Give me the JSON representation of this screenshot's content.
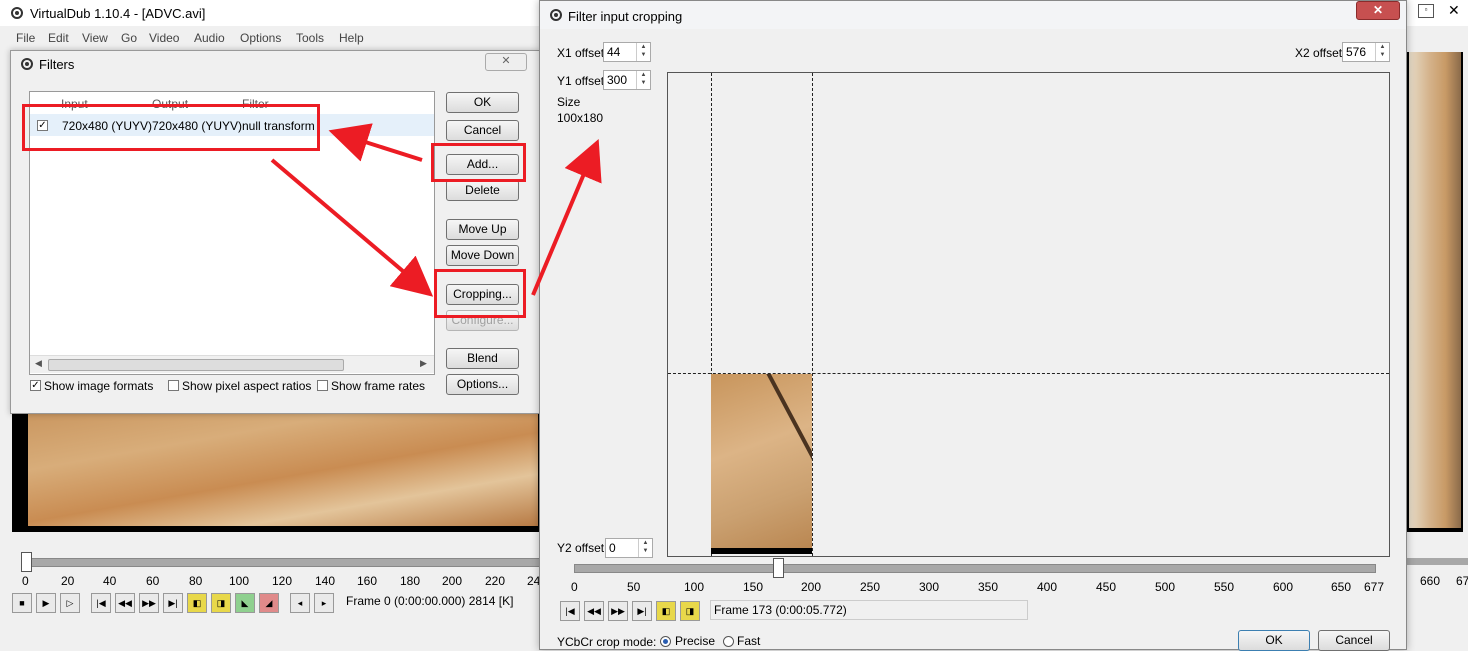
{
  "main_window": {
    "title": "VirtualDub 1.10.4 - [ADVC.avi]",
    "menu": [
      "File",
      "Edit",
      "View",
      "Go",
      "Video",
      "Audio",
      "Options",
      "Tools",
      "Help"
    ],
    "timeline_ticks": [
      "0",
      "20",
      "40",
      "60",
      "80",
      "100",
      "120",
      "140",
      "160",
      "180",
      "200",
      "220",
      "24"
    ],
    "right_ticks": [
      "660",
      "67"
    ],
    "frame_status": "Frame 0 (0:00:00.000) 2814 [K]"
  },
  "filters_dialog": {
    "title": "Filters",
    "columns": [
      "Input",
      "Output",
      "Filter"
    ],
    "rows": [
      {
        "checked": true,
        "input": "720x480 (YUYV)",
        "output": "720x480 (YUYV)",
        "filter": "null transform"
      }
    ],
    "buttons": {
      "ok": "OK",
      "cancel": "Cancel",
      "add": "Add...",
      "delete": "Delete",
      "move_up": "Move Up",
      "move_down": "Move Down",
      "cropping": "Cropping...",
      "configure": "Configure...",
      "blend": "Blend",
      "options": "Options..."
    },
    "checkboxes": {
      "show_image_formats": "Show image formats",
      "show_pixel_aspect": "Show pixel aspect ratios",
      "show_frame_rates": "Show frame rates"
    }
  },
  "crop_dialog": {
    "title": "Filter input cropping",
    "x1_label": "X1 offset",
    "x1_value": "44",
    "y1_label": "Y1 offset",
    "y1_value": "300",
    "x2_label": "X2 offset",
    "x2_value": "576",
    "y2_label": "Y2 offset",
    "y2_value": "0",
    "size_label": "Size",
    "size_value": "100x180",
    "slider_ticks": [
      "0",
      "50",
      "100",
      "150",
      "200",
      "250",
      "300",
      "350",
      "400",
      "450",
      "500",
      "550",
      "600",
      "650",
      "677"
    ],
    "frame_status": "Frame 173 (0:00:05.772)",
    "ycbcr_label": "YCbCr crop mode:",
    "mode_precise": "Precise",
    "mode_fast": "Fast",
    "ok": "OK",
    "cancel": "Cancel"
  },
  "colors": {
    "annotation": "#ec1c24",
    "close_button": "#c75050"
  }
}
